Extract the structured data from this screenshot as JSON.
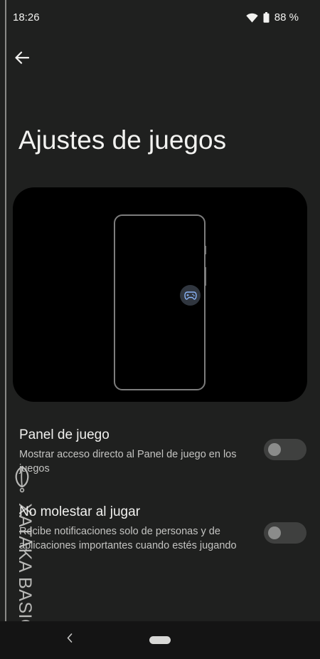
{
  "status_bar": {
    "time": "18:26",
    "battery": "88 %"
  },
  "header": {
    "title": "Ajustes de juegos"
  },
  "settings": [
    {
      "title": "Panel de juego",
      "description": "Mostrar acceso directo al Panel de juego en los juegos",
      "enabled": false
    },
    {
      "title": "No molestar al jugar",
      "description": "Recibe notificaciones solo de personas y de aplicaciones importantes cuando estés jugando",
      "enabled": false
    }
  ],
  "watermark": {
    "text": "XATAKA BASICS"
  },
  "colors": {
    "background": "#1f201f",
    "hero_background": "#000000",
    "toggle_off": "#3f403f",
    "game_icon": "#8ab4f8"
  },
  "icons": [
    "wifi-icon",
    "battery-icon",
    "back-arrow-icon",
    "gamepad-icon",
    "nav-back-icon",
    "home-pill"
  ]
}
